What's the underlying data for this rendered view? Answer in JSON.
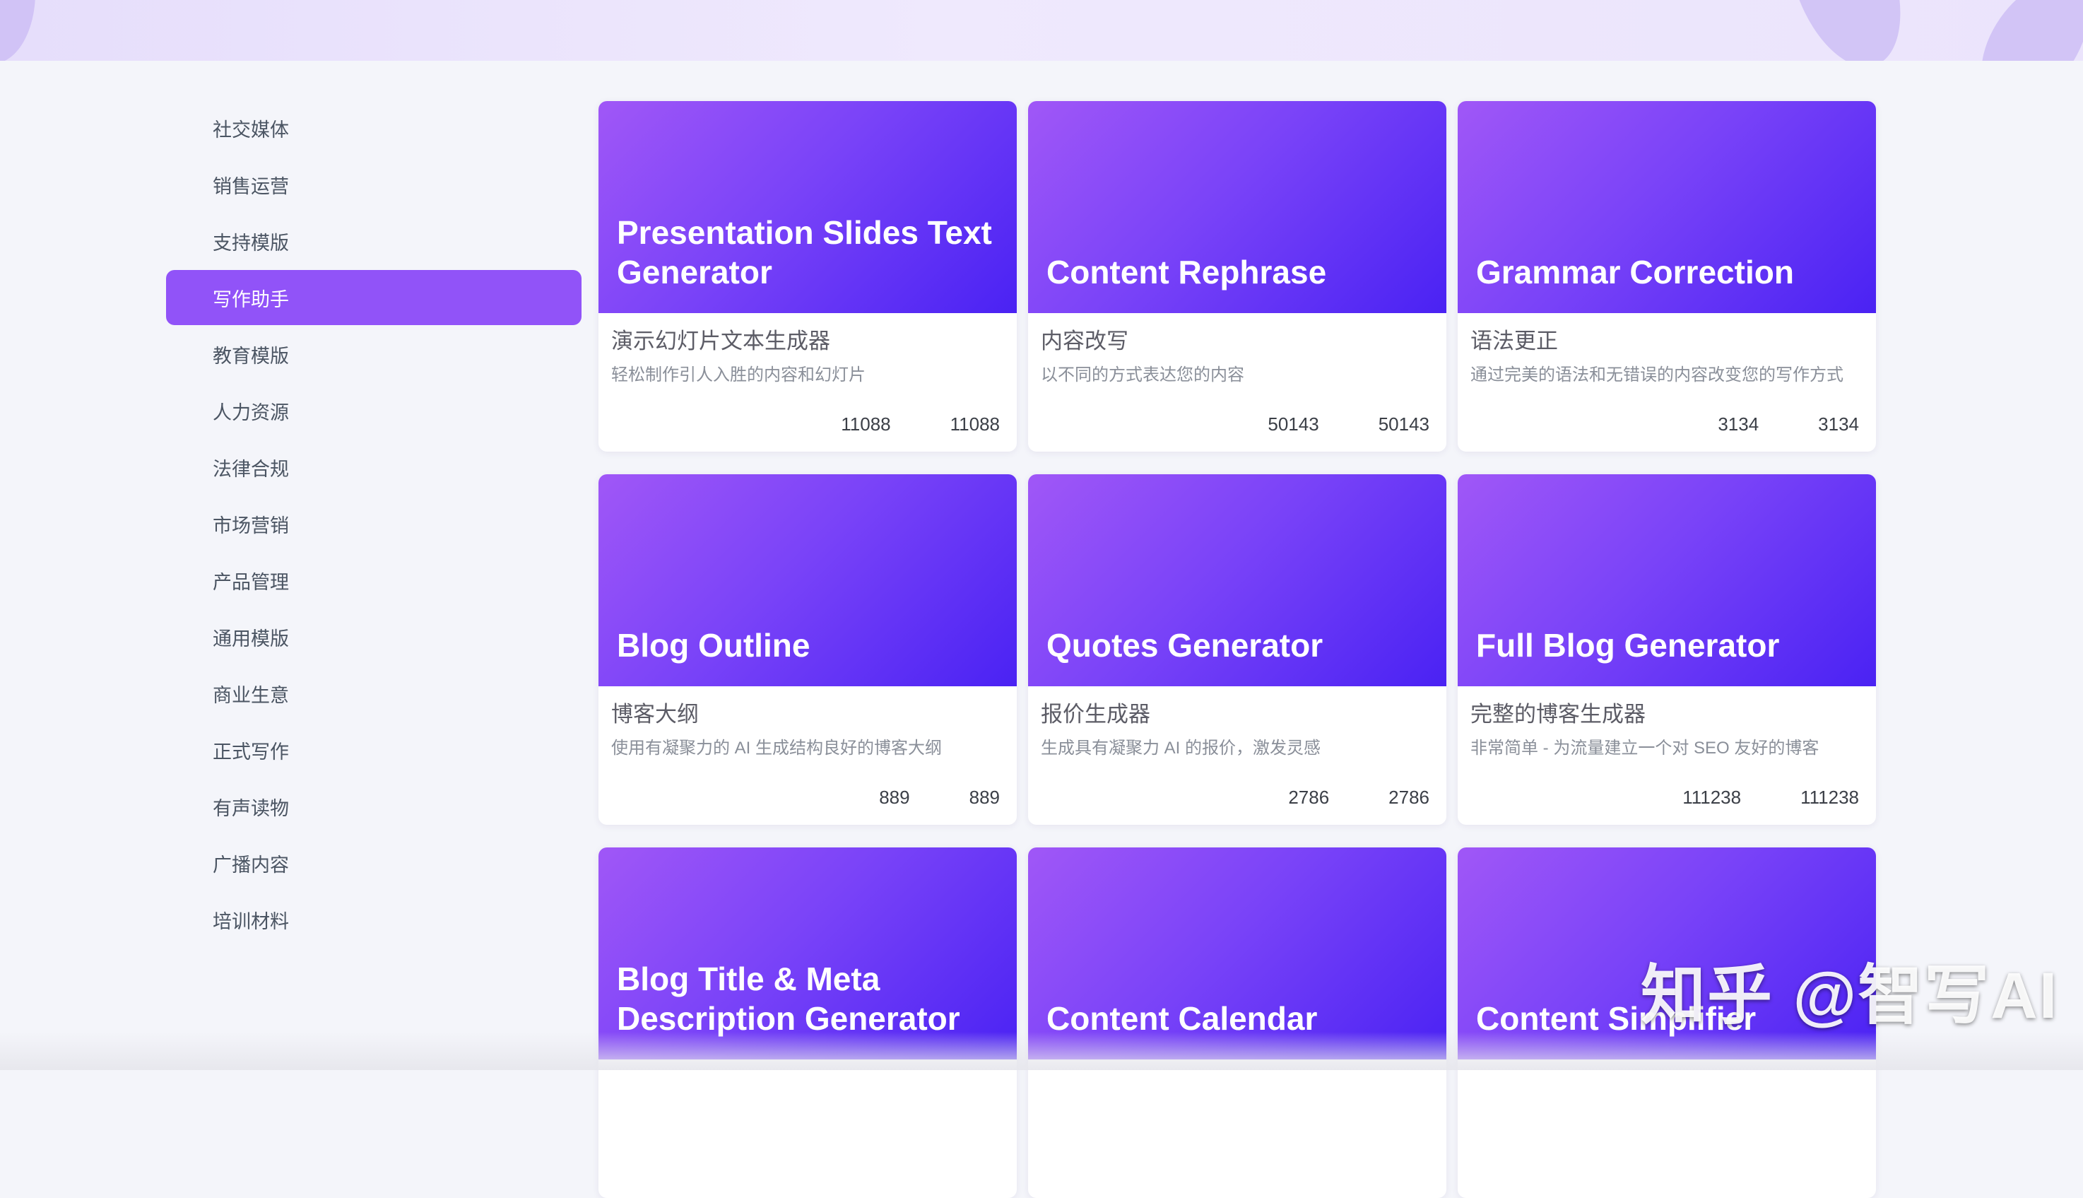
{
  "sidebar": {
    "items": [
      {
        "label": "社交媒体",
        "icon": "hashtag-icon",
        "active": false
      },
      {
        "label": "销售运营",
        "icon": "handshake-icon",
        "active": false
      },
      {
        "label": "支持模版",
        "icon": "headset-icon",
        "active": false
      },
      {
        "label": "写作助手",
        "icon": "pen-icon",
        "active": true
      },
      {
        "label": "教育模版",
        "icon": "book-reader-icon",
        "active": false
      },
      {
        "label": "人力资源",
        "icon": "people-network-icon",
        "active": false
      },
      {
        "label": "法律合规",
        "icon": "gavel-icon",
        "active": false
      },
      {
        "label": "市场营销",
        "icon": "rocket-icon",
        "active": false
      },
      {
        "label": "产品管理",
        "icon": "devices-icon",
        "active": false
      },
      {
        "label": "通用模版",
        "icon": "person-desk-icon",
        "active": false
      },
      {
        "label": "商业生意",
        "icon": "briefcase-icon",
        "active": false
      },
      {
        "label": "正式写作",
        "icon": "tie-icon",
        "active": false
      },
      {
        "label": "有声读物",
        "icon": "audiobook-icon",
        "active": false
      },
      {
        "label": "广播内容",
        "icon": "megaphone-icon",
        "active": false
      },
      {
        "label": "培训材料",
        "icon": "id-card-icon",
        "active": false
      }
    ]
  },
  "cards": [
    {
      "title": "Presentation Slides Text Generator",
      "cn_title": "演示幻灯片文本生成器",
      "desc": "轻松制作引人入胜的内容和幻灯片",
      "uses": "11088",
      "likes": "11088"
    },
    {
      "title": "Content Rephrase",
      "cn_title": "内容改写",
      "desc": "以不同的方式表达您的内容",
      "uses": "50143",
      "likes": "50143"
    },
    {
      "title": "Grammar Correction",
      "cn_title": "语法更正",
      "desc": "通过完美的语法和无错误的内容改变您的写作方式",
      "uses": "3134",
      "likes": "3134"
    },
    {
      "title": "Blog Outline",
      "cn_title": "博客大纲",
      "desc": "使用有凝聚力的 AI 生成结构良好的博客大纲",
      "uses": "889",
      "likes": "889"
    },
    {
      "title": "Quotes Generator",
      "cn_title": "报价生成器",
      "desc": "生成具有凝聚力 AI 的报价，激发灵感",
      "uses": "2786",
      "likes": "2786"
    },
    {
      "title": "Full Blog Generator",
      "cn_title": "完整的博客生成器",
      "desc": "非常简单 - 为流量建立一个对 SEO 友好的博客",
      "uses": "111238",
      "likes": "111238"
    },
    {
      "title": "Blog Title & Meta Description Generator",
      "cn_title": "",
      "desc": "",
      "uses": "",
      "likes": ""
    },
    {
      "title": "Content Calendar",
      "cn_title": "",
      "desc": "",
      "uses": "",
      "likes": ""
    },
    {
      "title": "Content Simplifier",
      "cn_title": "",
      "desc": "",
      "uses": "",
      "likes": ""
    }
  ],
  "watermark": "知乎 @智写AI",
  "colors": {
    "accent": "#9153f8",
    "card_gradient_start": "#a057f7",
    "card_gradient_end": "#4a22f3",
    "page_bg": "#f4f5fa"
  }
}
